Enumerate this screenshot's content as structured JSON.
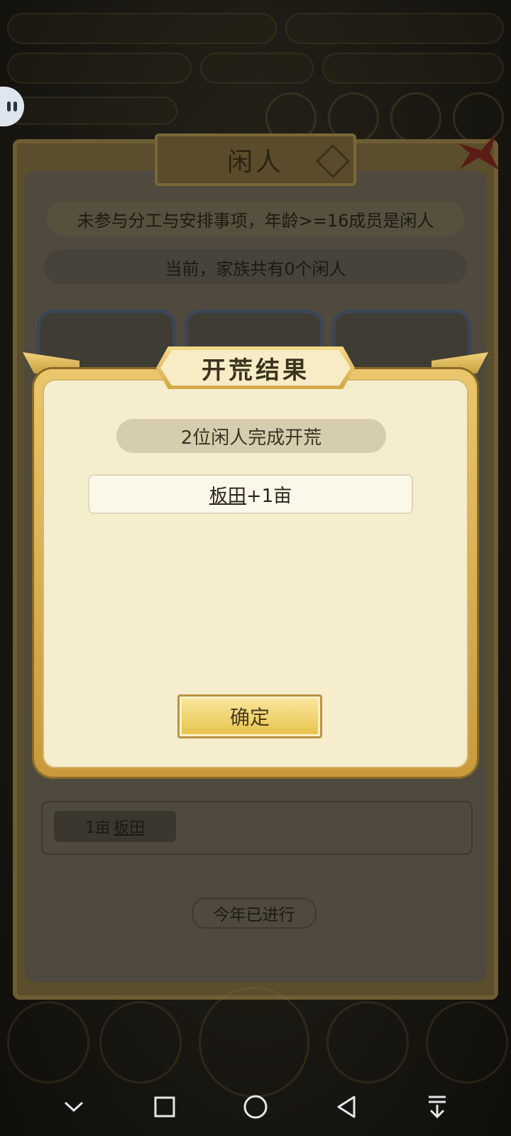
{
  "status_bar": {
    "left_label": "",
    "left_value": "",
    "right_value": ""
  },
  "background": {
    "panel_title": "闲人",
    "rule_text": "未参与分工与安排事项，年龄>=16成员是闲人",
    "idle_count_text": "当前，家族共有0个闲人",
    "land_amount": "1亩",
    "land_type": "板田",
    "year_status": "今年已进行"
  },
  "modal": {
    "title": "开荒结果",
    "summary": "2位闲人完成开荒",
    "result_land": "板田",
    "result_delta": "+1亩",
    "confirm_label": "确定"
  },
  "nav": {
    "icons": [
      "chevron-down-icon",
      "recent-apps-icon",
      "home-icon",
      "back-icon",
      "download-icon"
    ]
  },
  "colors": {
    "modal_bg": "#f6edcd",
    "modal_border": "#d9b456",
    "confirm_bg": "#e7c24a",
    "dim_bg": "#171510"
  }
}
